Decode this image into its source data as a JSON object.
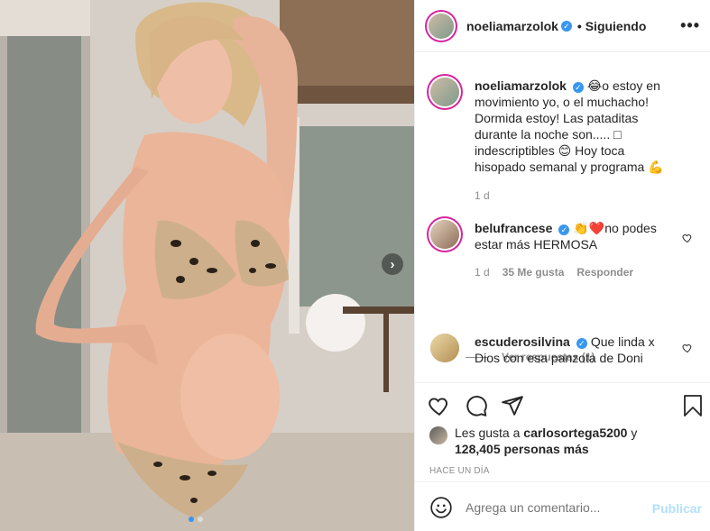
{
  "post": {
    "author": "noeliamarzolok",
    "follow_status": "• Siguiendo",
    "more_label": "•••",
    "caption": "😂o estoy en movimiento yo, o el muchacho! Dormida estoy! Las pataditas durante la noche son..... □ indescriptibles 😊 Hoy toca hisopado semanal y programa 💪",
    "caption_time": "1 d"
  },
  "comments": [
    {
      "user": "belufrancese",
      "text": "👏❤️no podes estar más HERMOSA",
      "time": "1 d",
      "likes": "35 Me gusta",
      "reply_label": "Responder",
      "view_replies": "Ver respuestas (1)"
    },
    {
      "user": "escuderosilvina",
      "text": "Que linda x Dios con esa panzota de Doni"
    }
  ],
  "likes": {
    "prefix": "Les gusta a ",
    "first_user": "carlosortega5200",
    "connector": " y",
    "others": "128,405 personas más"
  },
  "posted_time": "HACE UN DÍA",
  "comment_box": {
    "placeholder": "Agrega un comentario...",
    "publish_label": "Publicar",
    "emoji_icon": "smiley-icon"
  },
  "icons": [
    "heart-icon",
    "comment-icon",
    "share-icon",
    "bookmark-icon",
    "chevron-right-icon"
  ],
  "colors": {
    "verified": "#3897f0",
    "publish": "#b2dffc",
    "muted": "#8e8e8e",
    "text": "#262626"
  },
  "carousel": {
    "current": 1,
    "total": 2
  }
}
